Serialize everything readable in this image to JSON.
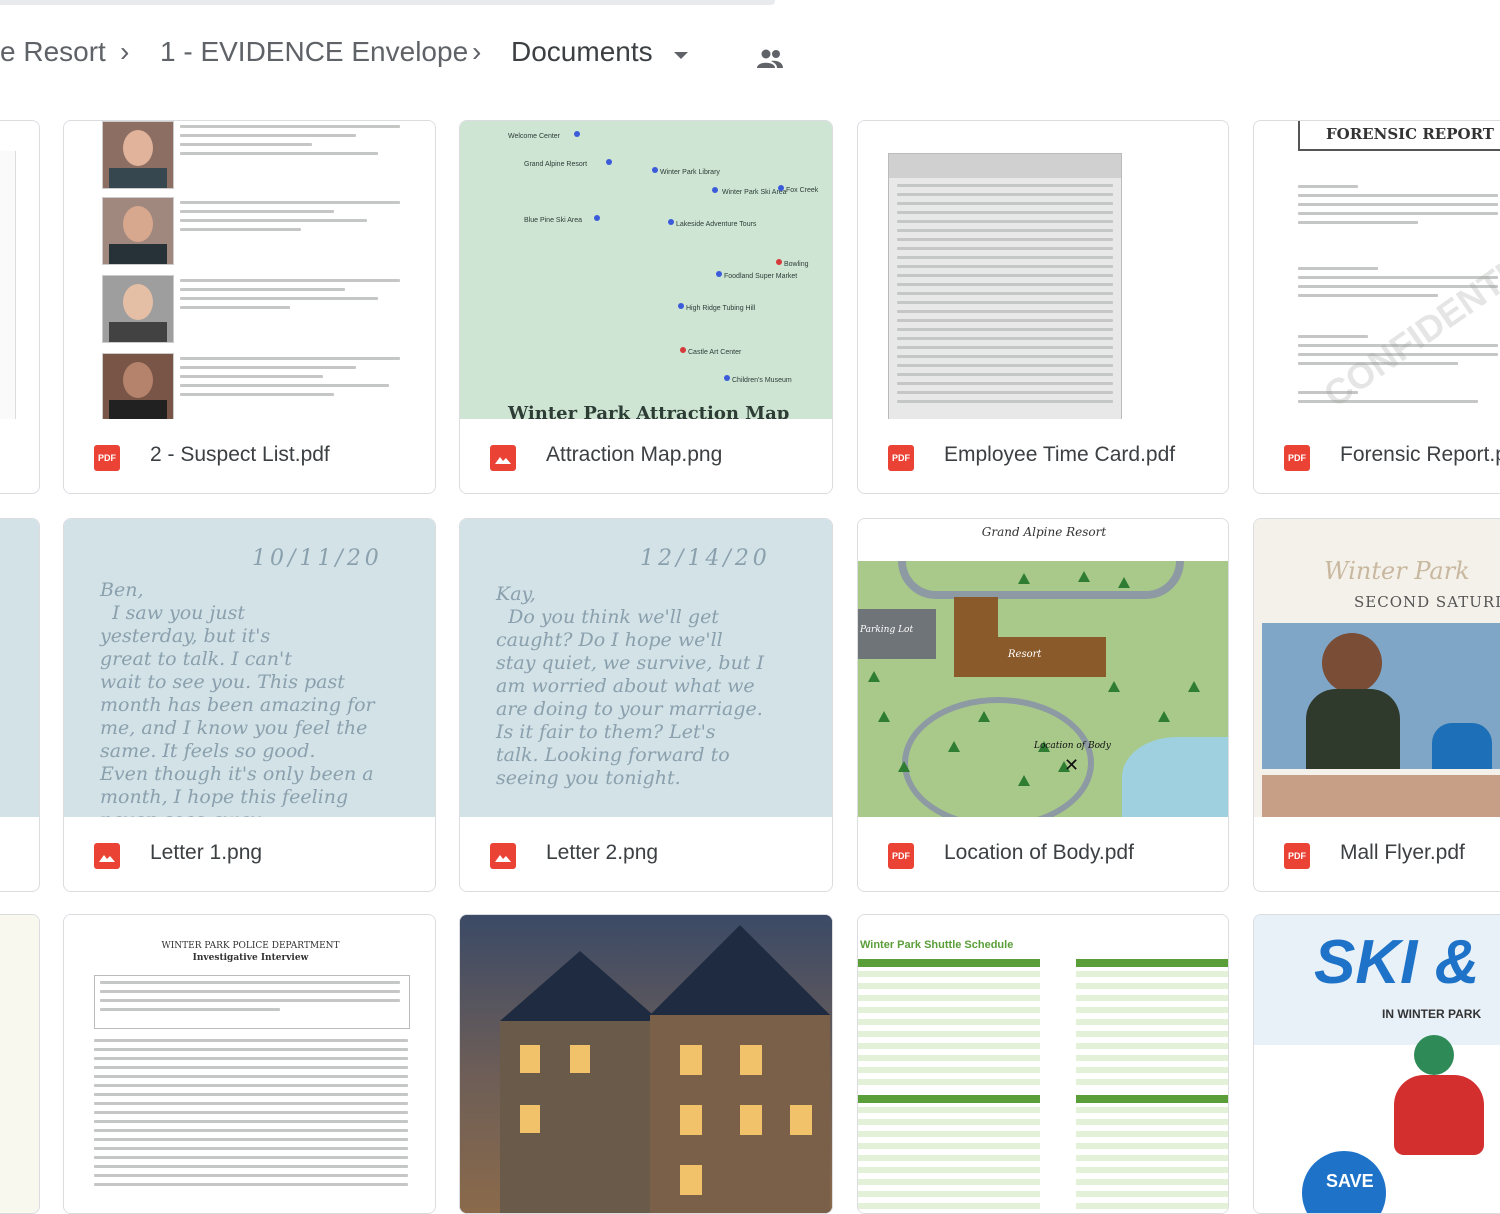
{
  "breadcrumb": {
    "items": [
      "e Resort",
      "1 - EVIDENCE Envelope",
      "Documents"
    ],
    "separator": "›"
  },
  "files": [
    {
      "name": "2 - Suspect List.pdf",
      "type": "pdf",
      "badge": "PDF"
    },
    {
      "name": "Attraction Map.png",
      "type": "image"
    },
    {
      "name": "Employee Time Card.pdf",
      "type": "pdf",
      "badge": "PDF"
    },
    {
      "name": "Forensic Report.p",
      "type": "pdf",
      "badge": "PDF"
    },
    {
      "name": "Letter 1.png",
      "type": "image"
    },
    {
      "name": "Letter 2.png",
      "type": "image"
    },
    {
      "name": "Location of Body.pdf",
      "type": "pdf",
      "badge": "PDF"
    },
    {
      "name": "Mall Flyer.pdf",
      "type": "pdf",
      "badge": "PDF"
    }
  ],
  "thumbs": {
    "map_title": "Winter Park Attraction Map",
    "map_labels": [
      "Welcome Center",
      "Grand Alpine Resort",
      "Winter Park Library",
      "Winter Park Ski Area",
      "Fox Creek",
      "Lakeside Adventure Tours",
      "Blue Pine Ski Area",
      "Foodland Super Market",
      "High Ridge Tubing Hill",
      "Children's Museum",
      "Castle Art Center",
      "Bowling"
    ],
    "forensic_title": "FORENSIC REPORT",
    "forensic_watermark": "CONFIDENTIAL",
    "letter1_date": "10/11/20",
    "letter1_text": "Ben,\n  I saw you just\nyesterday, but it's\ngreat to talk. I can't\nwait to see you. This past\nmonth has been amazing for\nme, and I know you feel the\nsame. It feels so good.\nEven though it's only been a\nmonth, I hope this feeling\nnever goes away.",
    "letter2_date": "12/14/20",
    "letter2_text": "Kay,\n  Do you think we'll get\ncaught? Do I hope we'll\nstay quiet, we survive, but I\nam worried about what we\nare doing to your marriage.\nIs it fair to them? Let's\ntalk. Looking forward to\nseeing you tonight.",
    "location_title": "Grand Alpine Resort",
    "location_parking": "Parking Lot",
    "location_resort": "Resort",
    "location_body": "Location of Body",
    "mall_script": "Winter Park",
    "mall_subtitle": "SECOND SATURDAY",
    "interview_title": "WINTER PARK POLICE DEPARTMENT",
    "interview_subtitle": "Investigative Interview",
    "shuttle_title": "Winter Park Shuttle Schedule",
    "ski_title": "SKI & TU",
    "ski_subtitle": "IN WINTER PARK",
    "ski_badge": "SAVE"
  },
  "colors": {
    "pdf_red": "#ea4335",
    "map_green": "#cfe5d4",
    "letter_blue": "#d3e2e7",
    "shuttle_green": "#5a9e3a"
  }
}
